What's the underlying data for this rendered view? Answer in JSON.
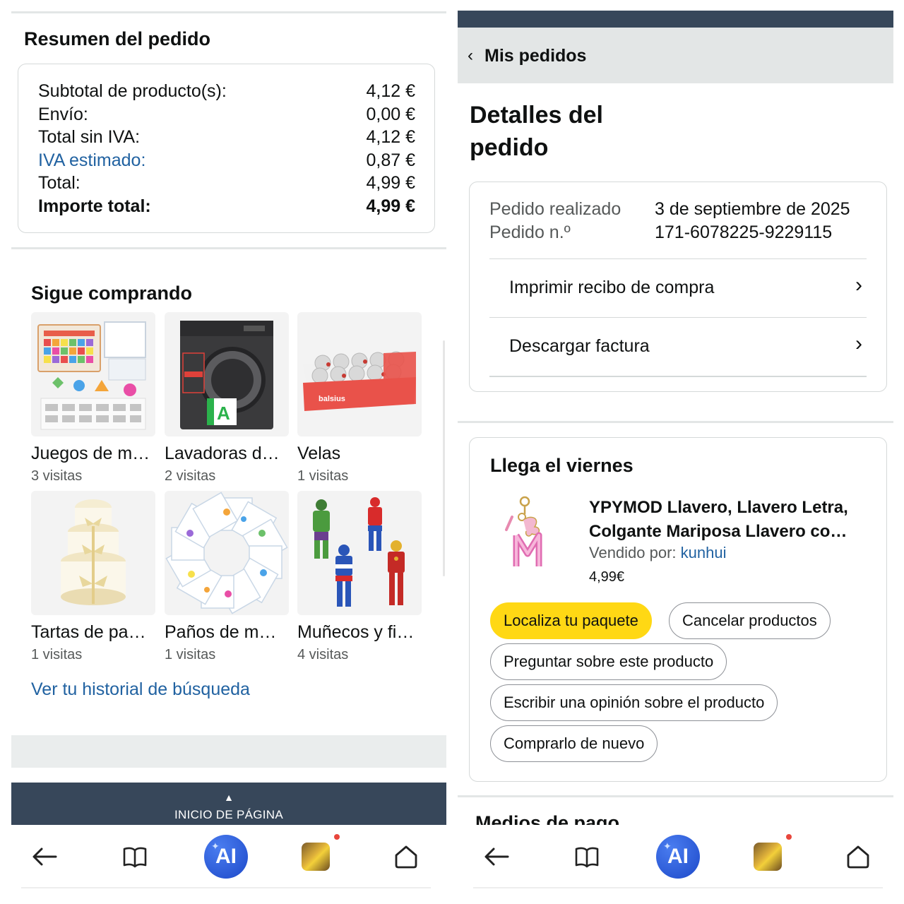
{
  "order_summary": {
    "title": "Resumen del pedido",
    "rows": [
      {
        "label": "Subtotal de producto(s):",
        "value": "4,12 €"
      },
      {
        "label": "Envío:",
        "value": "0,00 €"
      },
      {
        "label": "Total sin IVA:",
        "value": "4,12 €"
      },
      {
        "label": "IVA estimado:",
        "value": "0,87 €"
      },
      {
        "label": "Total:",
        "value": "4,99 €"
      },
      {
        "label": "Importe total:",
        "value": "4,99 €"
      }
    ]
  },
  "keep_shopping": {
    "title": "Sigue comprando",
    "items": [
      {
        "name": "Juegos de m…",
        "visits": "3 visitas"
      },
      {
        "name": "Lavadoras d…",
        "visits": "2 visitas"
      },
      {
        "name": "Velas",
        "visits": "1 visitas"
      },
      {
        "name": "Tartas de pa…",
        "visits": "1 visitas"
      },
      {
        "name": "Paños de m…",
        "visits": "1 visitas"
      },
      {
        "name": "Muñecos y fi…",
        "visits": "4 visitas"
      }
    ],
    "history_link": "Ver tu historial de búsqueda"
  },
  "footer": {
    "back_to_top": "INICIO DE PÁGINA"
  },
  "browser_bar": {
    "ai_label": "AI"
  },
  "order_details": {
    "nav_back": "Mis pedidos",
    "title": "Detalles del pedido",
    "placed_label": "Pedido realizado",
    "placed_value": "3 de septiembre de 2025",
    "number_label": "Pedido n.º",
    "number_value": "171-6078225-9229115",
    "print_receipt": "Imprimir recibo de compra",
    "download_invoice": "Descargar factura"
  },
  "shipment": {
    "title": "Llega el viernes",
    "product_line1": "YPYMOD Llavero, Llavero Letra,",
    "product_line2": "Colgante Mariposa Llavero co…",
    "sold_by_label": "Vendido por:",
    "seller": "kunhui",
    "price": "4,99€",
    "buttons": {
      "track": "Localiza tu paquete",
      "cancel": "Cancelar productos",
      "ask": "Preguntar sobre este producto",
      "review": "Escribir una opinión sobre el producto",
      "buy_again": "Comprarlo de nuevo"
    }
  },
  "payment": {
    "title": "Medios de pago"
  },
  "colors": {
    "accent_link": "#2162a1",
    "track_button": "#ffd814",
    "footer_dark": "#37475a"
  }
}
